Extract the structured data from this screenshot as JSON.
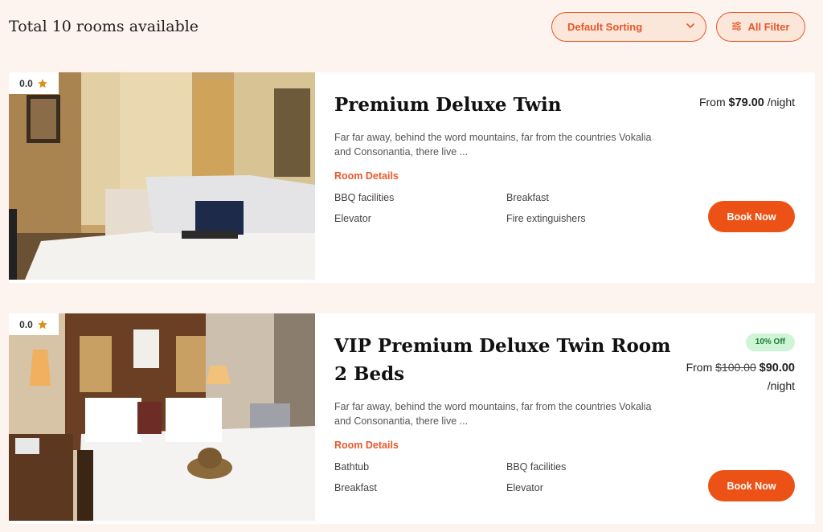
{
  "header": {
    "total_text": "Total 10 rooms available",
    "sort_label": "Default Sorting",
    "filter_label": "All Filter"
  },
  "colors": {
    "accent": "#ec5215",
    "background": "#fdf3ef",
    "badge_bg": "#cdf5d6",
    "badge_text": "#1f7a35"
  },
  "rooms": [
    {
      "rating": "0.0",
      "title": "Premium Deluxe Twin",
      "description": "Far far away, behind the word mountains, far from the countries Vokalia and Consonantia, there live ...",
      "details_label": "Room Details",
      "amenities": [
        "BBQ facilities",
        "Breakfast",
        "Elevator",
        "Fire extinguishers"
      ],
      "price_prefix": "From",
      "price": "$79.00",
      "per": "/night",
      "book_label": "Book Now"
    },
    {
      "rating": "0.0",
      "title": "VIP Premium Deluxe Twin Room 2 Beds",
      "description": "Far far away, behind the word mountains, far from the countries Vokalia and Consonantia, there live ...",
      "details_label": "Room Details",
      "amenities": [
        "Bathtub",
        "BBQ facilities",
        "Breakfast",
        "Elevator"
      ],
      "discount_badge": "10% Off",
      "price_prefix": "From",
      "old_price": "$100.00",
      "price": "$90.00",
      "per": "/night",
      "book_label": "Book Now"
    }
  ]
}
